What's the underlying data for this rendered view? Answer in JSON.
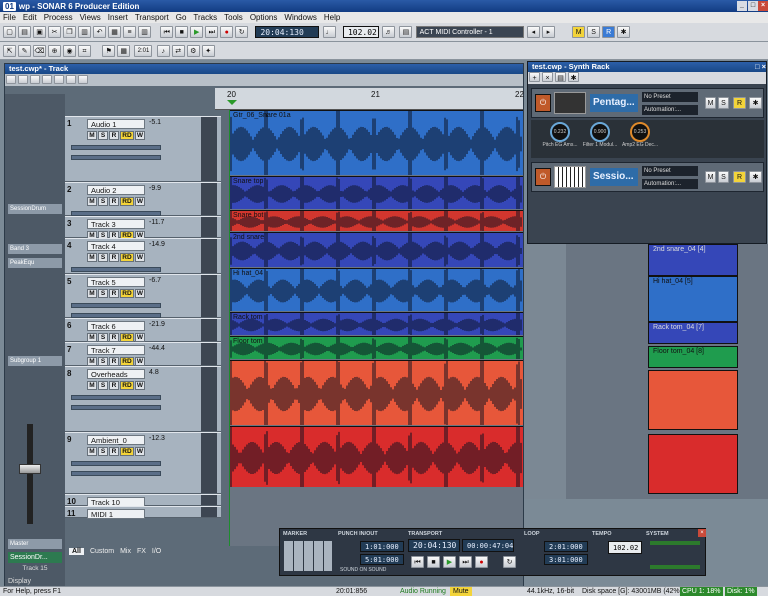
{
  "window": {
    "badge": "01",
    "title": "wp - SONAR 6 Producer Edition"
  },
  "menu": [
    "File",
    "Edit",
    "Process",
    "Views",
    "Insert",
    "Transport",
    "Go",
    "Tracks",
    "Tools",
    "Options",
    "Windows",
    "Help"
  ],
  "toolbar": {
    "time": "20:04:130",
    "tempo": "102.02",
    "controller": "ACT MIDI Controller - 1",
    "msr": [
      "M",
      "S",
      "R"
    ],
    "snap": "2:01"
  },
  "track_window": {
    "title": "test.cwp* - Track",
    "ruler": [
      "20",
      "21",
      "22"
    ],
    "tracks": [
      {
        "num": "1",
        "name": "Audio 1",
        "val": "-5.1",
        "color": "#2f6fc8",
        "clip": "Gtr_06_Snare 01a"
      },
      {
        "num": "2",
        "name": "Audio 2",
        "val": "-9.9",
        "color": "#3547b8",
        "clip": "Snare top"
      },
      {
        "num": "3",
        "name": "Track 3",
        "val": "-11.7",
        "color": "#d2362e",
        "clip": "Snare bot"
      },
      {
        "num": "4",
        "name": "Track 4",
        "val": "-14.9",
        "color": "#3547b8",
        "clip": "2nd snare"
      },
      {
        "num": "5",
        "name": "Track 5",
        "val": "-6.7",
        "color": "#2f6fc8",
        "clip": "Hi hat_04"
      },
      {
        "num": "6",
        "name": "Track 6",
        "val": "-21.9",
        "color": "#3547b8",
        "clip": "Rack tom"
      },
      {
        "num": "7",
        "name": "Track 7",
        "val": "-44.4",
        "color": "#1f9c4e",
        "clip": "Floor tom"
      },
      {
        "num": "8",
        "name": "Overheads",
        "val": "4.8",
        "color": "#e7573a",
        "clip": ""
      },
      {
        "num": "9",
        "name": "Ambient_0",
        "val": "-12.3",
        "color": "#d92c2c",
        "clip": ""
      },
      {
        "num": "10",
        "name": "Track 10",
        "val": "",
        "color": "#556070",
        "clip": ""
      },
      {
        "num": "11",
        "name": "MIDI 1",
        "val": "",
        "color": "#556070",
        "clip": ""
      }
    ],
    "right_clips": [
      "2nd snare_04 [4]",
      "Hi hat_04 [5]",
      "Rack tom_04 [7]",
      "Floor tom_04 [8]"
    ],
    "tabs": [
      "All",
      "Custom",
      "Mix",
      "FX",
      "I/O"
    ],
    "strip": {
      "session": "SessionDrum",
      "band": "Band 3",
      "peak": "PeakEqu",
      "sub": "Subgroup 1",
      "master": "Master",
      "sessdr": "SessionDr...",
      "track15": "Track 15",
      "display": "Display"
    }
  },
  "synth": {
    "title": "test.cwp - Synth Rack",
    "inst1": "Pentag...",
    "inst2": "Sessio...",
    "preset": "No Preset",
    "auto": "Automation:...",
    "knobs": [
      "Pitch EG Ams...",
      "Filter 1 Modul...",
      "Amp2 EG Dec..."
    ],
    "knobvals": [
      "0.232",
      "0.900",
      "0.253"
    ]
  },
  "transport": {
    "sections": [
      "MARKER",
      "PUNCH IN/OUT",
      "TRANSPORT",
      "LOOP",
      "TEMPO",
      "SYSTEM"
    ],
    "time": "20:04:130",
    "time2": "00:00:47:04",
    "punch1": "1:01:000",
    "punch2": "5:01:000",
    "loop1": "2:01:000",
    "loop2": "3:01:000",
    "tempo": "102.02",
    "sound": "SOUND ON SOUND"
  },
  "status": {
    "help": "For Help, press F1",
    "time": "20:01:856",
    "audio": "Audio Running",
    "mute": "Mute",
    "rate": "44.1kHz, 16-bit",
    "disk": "Disk space [G]: 43001MB (42%)",
    "cpu": "CPU 1: 18%",
    "disk2": "Disk: 1%"
  }
}
